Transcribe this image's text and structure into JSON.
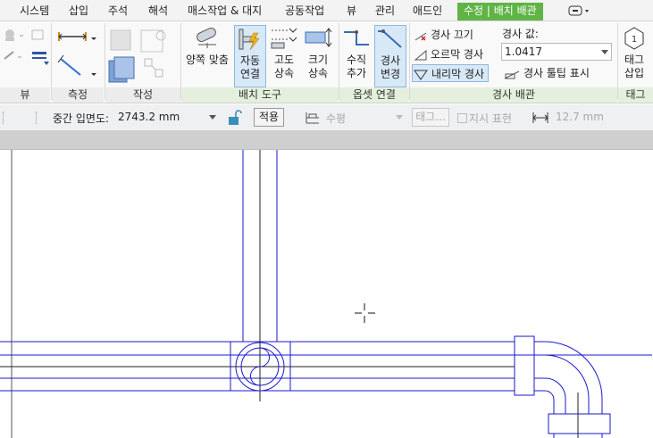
{
  "menu": {
    "tabs": [
      "시스템",
      "삽입",
      "주석",
      "해석",
      "매스작업 & 대지",
      "공동작업",
      "뷰",
      "관리",
      "애드인"
    ],
    "active_tab": "수정 | 배치 배관"
  },
  "ribbon": {
    "panels": {
      "view": "뷰",
      "measure": "측정",
      "create": "작성",
      "placement_tools": "배치 도구",
      "offset_connect": "옵셋 연결",
      "sloped_piping": "경사 배관",
      "tag": "태그"
    },
    "buttons": {
      "justify": "양쪽 맞춤",
      "auto_connect": [
        "자동",
        "연결"
      ],
      "inherit_elevation": [
        "고도",
        "상속"
      ],
      "inherit_size": [
        "크기",
        "상속"
      ],
      "add_vertical": [
        "수직",
        "추가"
      ],
      "change_slope": [
        "경사",
        "변경"
      ],
      "slope_off": "경사 끄기",
      "slope_up": "오르막 경사",
      "slope_down": "내리막 경사",
      "show_slope_tooltip": "경사 툴팁 표시",
      "tag_on_placement": [
        "태그",
        "삽입"
      ]
    },
    "slope": {
      "label": "경사 값:",
      "value": "1.0417"
    }
  },
  "options_bar": {
    "middle_elevation_label": "중간 입면도:",
    "middle_elevation_value": "2743.2 mm",
    "apply_label": "적용",
    "horizontal_value": "수평",
    "tag_label": "태그...",
    "show_label": "지시 표현",
    "size_value": "12.7 mm"
  },
  "colors": {
    "accent_tab": "#5fb445",
    "pipe": "#1a1acc",
    "pressed_bg": "#d7e8f7"
  }
}
